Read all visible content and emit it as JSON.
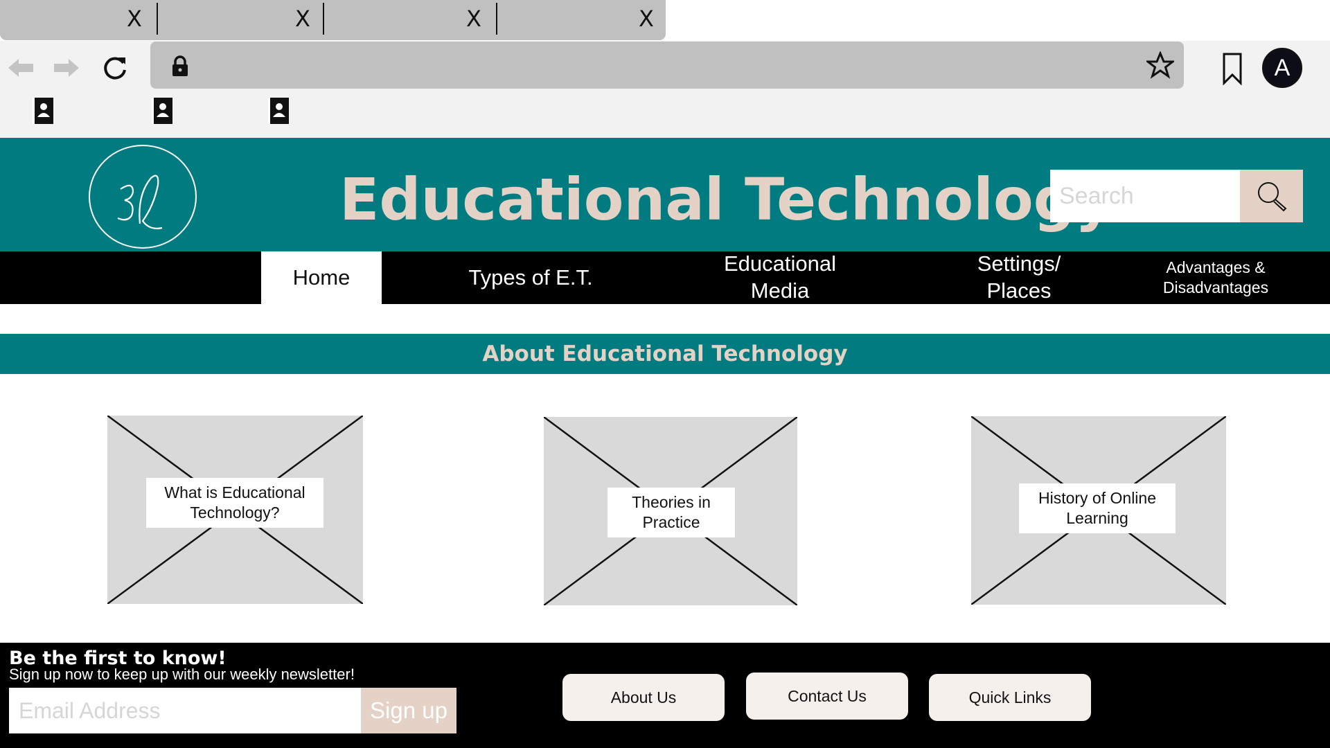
{
  "browser": {
    "tabs": [
      {
        "close_label": "X"
      },
      {
        "close_label": "X"
      },
      {
        "close_label": "X"
      },
      {
        "close_label": "X"
      }
    ],
    "avatar_letter": "A",
    "icons": {
      "back": "arrow-left-icon",
      "forward": "arrow-right-icon",
      "reload": "reload-icon",
      "lock": "lock-icon",
      "star": "star-icon",
      "bookmark": "bookmark-icon",
      "bookmark_items": "contact-book-icon"
    }
  },
  "header": {
    "title": "Educational Technology",
    "search_placeholder": "Search",
    "logo_icon": "signature-logo-icon",
    "search_icon": "search-icon"
  },
  "nav": {
    "items": [
      {
        "label": "Home",
        "active": true
      },
      {
        "label": "Types of E.T.",
        "active": false
      },
      {
        "label": "Educational Media",
        "active": false
      },
      {
        "label": "Settings/ Places",
        "active": false
      },
      {
        "label": "Advantages & Disadvantages",
        "active": false
      }
    ]
  },
  "section": {
    "title": "About Educational Technology"
  },
  "cards": [
    {
      "label": "What is Educational Technology?"
    },
    {
      "label": "Theories in Practice"
    },
    {
      "label": "History of Online Learning"
    }
  ],
  "footer": {
    "newsletter_title": "Be the first to know!",
    "newsletter_subtitle": "Sign up now to keep up with our weekly newsletter!",
    "email_placeholder": "Email Address",
    "signup_label": "Sign up",
    "links": [
      {
        "label": "About Us"
      },
      {
        "label": "Contact Us"
      },
      {
        "label": "Quick Links"
      }
    ]
  },
  "colors": {
    "teal": "#007c80",
    "beige": "#e3d2c5",
    "chrome_gray": "#c0c0c0",
    "placeholder_gray": "#d9d9d9"
  }
}
